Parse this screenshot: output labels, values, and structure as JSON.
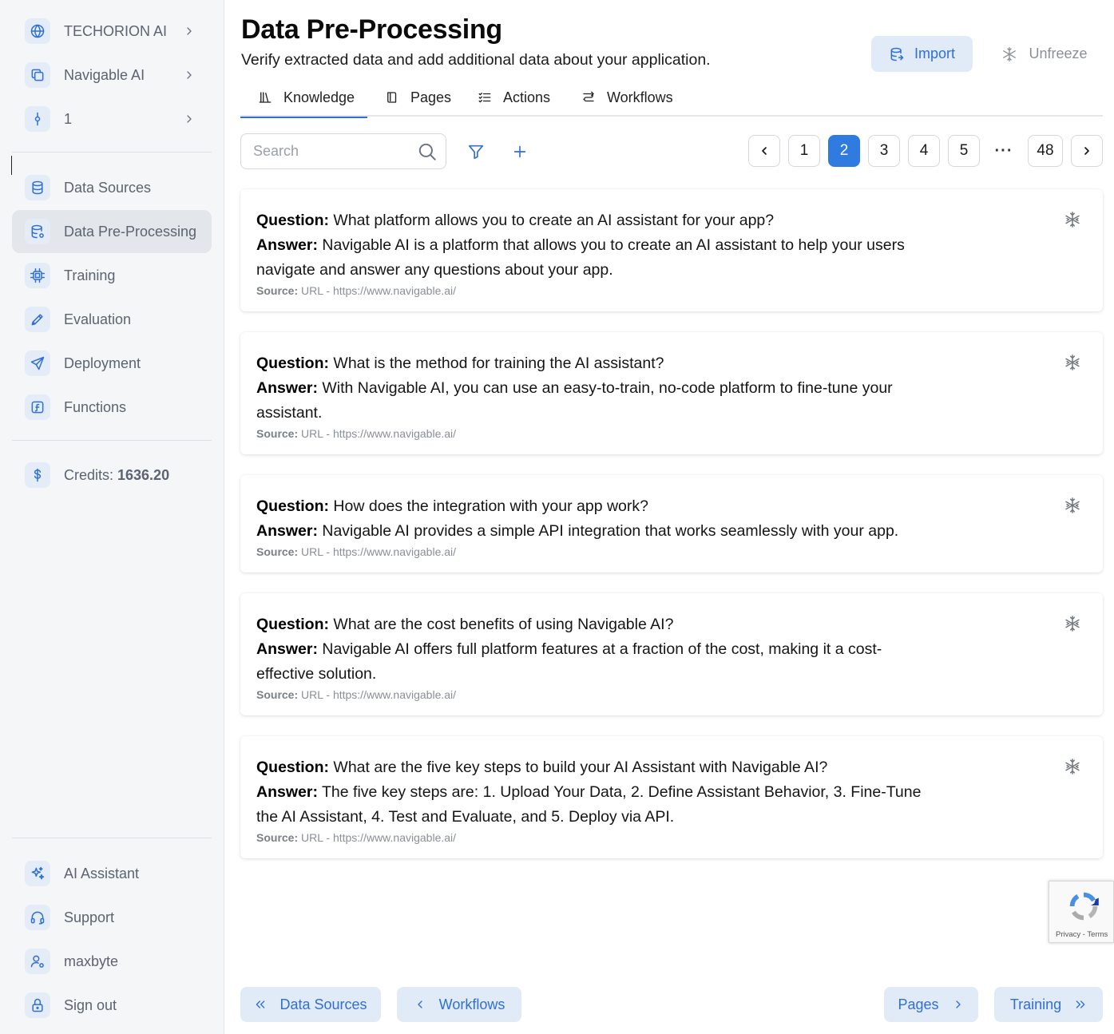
{
  "sidebar": {
    "top": [
      {
        "name": "org",
        "label": "TECHORION AI",
        "icon": "globe-icon"
      },
      {
        "name": "project",
        "label": "Navigable AI",
        "icon": "copy-icon"
      },
      {
        "name": "version",
        "label": "1",
        "icon": "git-commit-icon"
      }
    ],
    "nav": [
      {
        "label": "Data Sources",
        "icon": "database-icon"
      },
      {
        "label": "Data Pre-Processing",
        "icon": "database-settings-icon",
        "active": true
      },
      {
        "label": "Training",
        "icon": "cpu-icon"
      },
      {
        "label": "Evaluation",
        "icon": "pen-tool-icon"
      },
      {
        "label": "Deployment",
        "icon": "send-icon"
      },
      {
        "label": "Functions",
        "icon": "function-icon"
      }
    ],
    "credits": {
      "label": "Credits:",
      "value": "1636.20",
      "icon": "dollar-icon"
    },
    "bottom": [
      {
        "label": "AI Assistant",
        "icon": "sparkles-icon"
      },
      {
        "label": "Support",
        "icon": "headset-icon"
      },
      {
        "label": "maxbyte",
        "icon": "user-settings-icon"
      },
      {
        "label": "Sign out",
        "icon": "lock-icon"
      }
    ]
  },
  "header": {
    "title": "Data Pre-Processing",
    "subtitle": "Verify extracted data and add additional data about your application.",
    "import_label": "Import",
    "unfreeze_label": "Unfreeze"
  },
  "tabs": [
    {
      "label": "Knowledge",
      "icon": "library-icon",
      "active": true
    },
    {
      "label": "Pages",
      "icon": "book-open-icon"
    },
    {
      "label": "Actions",
      "icon": "list-checks-icon"
    },
    {
      "label": "Workflows",
      "icon": "route-icon"
    }
  ],
  "search": {
    "placeholder": "Search",
    "value": ""
  },
  "pagination": {
    "pages": [
      "1",
      "2",
      "3",
      "4",
      "5"
    ],
    "current": "2",
    "ellipsis": "···",
    "last": "48"
  },
  "qa_labels": {
    "question": "Question:",
    "answer": "Answer:",
    "source": "Source:"
  },
  "cards": [
    {
      "question": "What platform allows you to create an AI assistant for your app?",
      "answer": "Navigable AI is a platform that allows you to create an AI assistant to help your users navigate and answer any questions about your app.",
      "source": "URL - https://www.navigable.ai/"
    },
    {
      "question": "What is the method for training the AI assistant?",
      "answer": "With Navigable AI, you can use an easy-to-train, no-code platform to fine-tune your assistant.",
      "source": "URL - https://www.navigable.ai/"
    },
    {
      "question": "How does the integration with your app work?",
      "answer": "Navigable AI provides a simple API integration that works seamlessly with your app.",
      "source": "URL - https://www.navigable.ai/"
    },
    {
      "question": "What are the cost benefits of using Navigable AI?",
      "answer": "Navigable AI offers full platform features at a fraction of the cost, making it a cost-effective solution.",
      "source": "URL - https://www.navigable.ai/"
    },
    {
      "question": "What are the five key steps to build your AI Assistant with Navigable AI?",
      "answer": "The five key steps are: 1. Upload Your Data, 2. Define Assistant Behavior, 3. Fine-Tune the AI Assistant, 4. Test and Evaluate, and 5. Deploy via API.",
      "source": "URL - https://www.navigable.ai/"
    }
  ],
  "recaptcha": {
    "terms": "Privacy - Terms"
  },
  "bottom_nav": {
    "first": "Data Sources",
    "prev": "Workflows",
    "next": "Pages",
    "last": "Training"
  },
  "colors": {
    "accent": "#2f6fd6",
    "accent_bg": "#e1ebf8",
    "sidebar_bg": "#f4f6f8",
    "active_page": "#2f7be0"
  }
}
